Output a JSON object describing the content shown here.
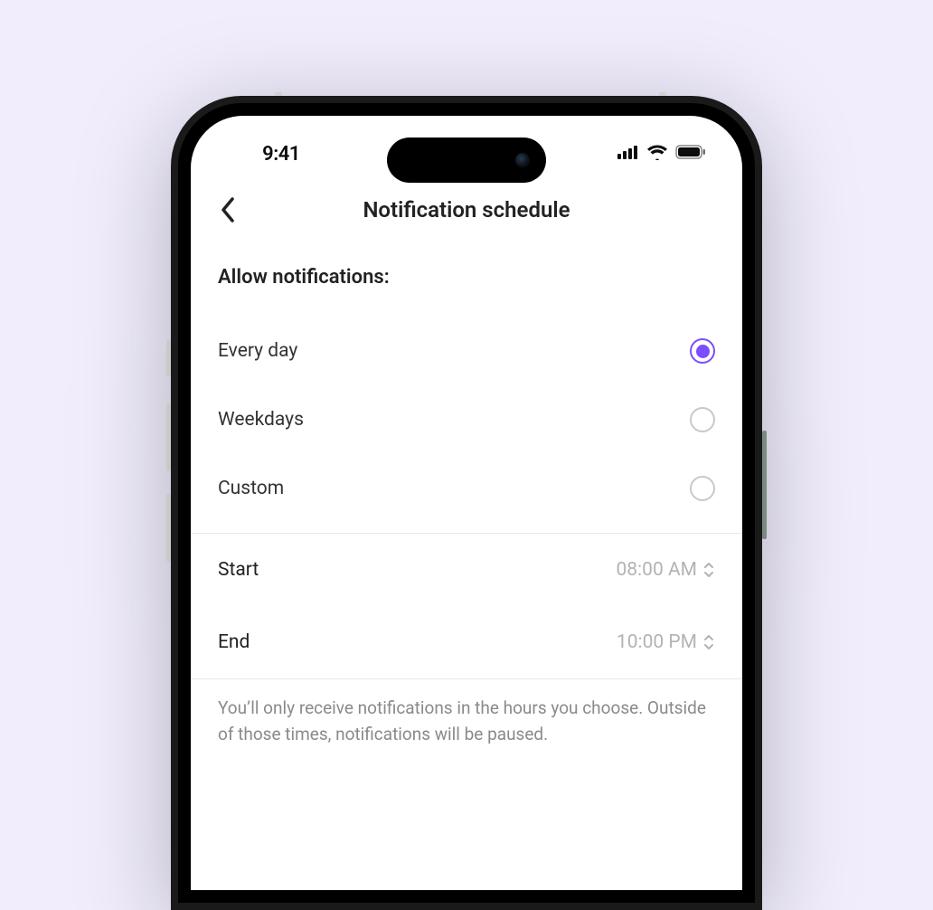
{
  "status": {
    "time": "9:41"
  },
  "header": {
    "title": "Notification schedule"
  },
  "section": {
    "label": "Allow notifications:"
  },
  "options": [
    {
      "label": "Every day",
      "selected": true
    },
    {
      "label": "Weekdays",
      "selected": false
    },
    {
      "label": "Custom",
      "selected": false
    }
  ],
  "times": {
    "start_label": "Start",
    "start_value": "08:00 AM",
    "end_label": "End",
    "end_value": "10:00 PM"
  },
  "footer": {
    "text": "You’ll only receive notifications in the hours you choose. Outside of those times, notifications will be paused."
  },
  "colors": {
    "accent": "#7c4dff"
  }
}
